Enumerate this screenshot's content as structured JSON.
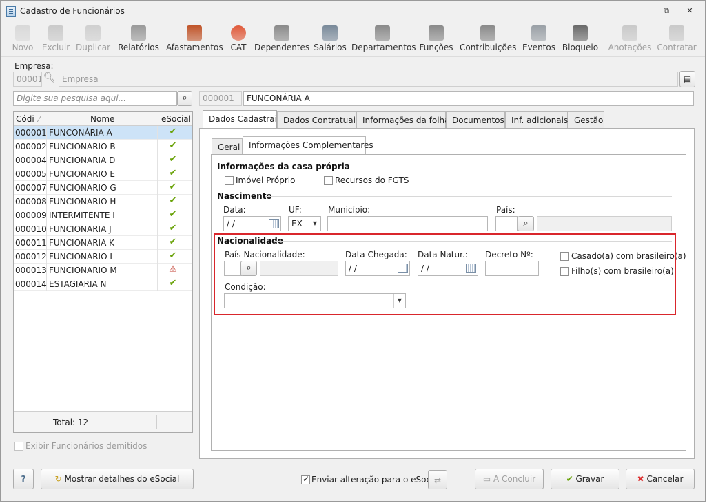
{
  "window": {
    "title": "Cadastro de Funcionários",
    "restore_glyph": "⧉",
    "close_glyph": "✕"
  },
  "toolbar": [
    {
      "label": "Novo",
      "enabled": false,
      "icon": "new-icon"
    },
    {
      "label": "Excluir",
      "enabled": false,
      "icon": "trash-icon"
    },
    {
      "label": "Duplicar",
      "enabled": false,
      "icon": "duplicate-icon"
    },
    {
      "label": "Relatórios",
      "enabled": true,
      "icon": "report-icon"
    },
    {
      "label": "Afastamentos",
      "enabled": true,
      "icon": "house-icon"
    },
    {
      "label": "CAT",
      "enabled": true,
      "icon": "red-cross-icon"
    },
    {
      "label": "Dependentes",
      "enabled": true,
      "icon": "people-icon"
    },
    {
      "label": "Salários",
      "enabled": true,
      "icon": "money-icon"
    },
    {
      "label": "Departamentos",
      "enabled": true,
      "icon": "desk-icon"
    },
    {
      "label": "Funções",
      "enabled": true,
      "icon": "badge-icon"
    },
    {
      "label": "Contribuições",
      "enabled": true,
      "icon": "heads-icon"
    },
    {
      "label": "Eventos",
      "enabled": true,
      "icon": "list-icon"
    },
    {
      "label": "Bloqueio",
      "enabled": true,
      "icon": "lock-icon"
    },
    {
      "label": "Anotações",
      "enabled": false,
      "icon": "note-icon"
    },
    {
      "label": "Contratar",
      "enabled": false,
      "icon": "contract-icon"
    }
  ],
  "empresa": {
    "label": "Empresa:",
    "code": "00001",
    "placeholder": "Empresa"
  },
  "search": {
    "placeholder": "Digite sua pesquisa aqui..."
  },
  "selected": {
    "code": "000001",
    "name": "FUNCONÁRIA A"
  },
  "grid": {
    "headers": [
      "Códi",
      "Nome",
      "eSocial"
    ],
    "rows": [
      {
        "code": "000001",
        "name": "FUNCONÁRIA A",
        "status": "✔",
        "warn": false
      },
      {
        "code": "000002",
        "name": "FUNCIONARIO B",
        "status": "✔",
        "warn": false
      },
      {
        "code": "000004",
        "name": "FUNCIONARIA D",
        "status": "✔",
        "warn": false
      },
      {
        "code": "000005",
        "name": "FUNCIONARIO E",
        "status": "✔",
        "warn": false
      },
      {
        "code": "000007",
        "name": "FUNCIONARIO G",
        "status": "✔",
        "warn": false
      },
      {
        "code": "000008",
        "name": "FUNCIONARIO H",
        "status": "✔",
        "warn": false
      },
      {
        "code": "000009",
        "name": "INTERMITENTE I",
        "status": "✔",
        "warn": false
      },
      {
        "code": "000010",
        "name": "FUNCIONARIA J",
        "status": "✔",
        "warn": false
      },
      {
        "code": "000011",
        "name": "FUNCIONARIA K",
        "status": "✔",
        "warn": false
      },
      {
        "code": "000012",
        "name": "FUNCIONARIO L",
        "status": "✔",
        "warn": false
      },
      {
        "code": "000013",
        "name": "FUNCIONARIO M",
        "status": "⚠",
        "warn": true
      },
      {
        "code": "000014",
        "name": "ESTAGIARIA N",
        "status": "✔",
        "warn": false
      }
    ],
    "total": "Total: 12"
  },
  "show_dismissed": "Exibir Funcionários demitidos",
  "tabs": [
    "Dados Cadastrais",
    "Dados Contratuais",
    "Informações da folha",
    "Documentos",
    "Inf. adicionais",
    "Gestão"
  ],
  "subtabs": [
    "Geral",
    "Informações Complementares"
  ],
  "casa": {
    "title": "Informações da casa própria",
    "imovel": "Imóvel Próprio",
    "fgts": "Recursos do FGTS"
  },
  "nascimento": {
    "title": "Nascimento",
    "data_label": "Data:",
    "data_value": " / /",
    "uf_label": "UF:",
    "uf_value": "EX",
    "municipio_label": "Município:",
    "pais_label": "País:"
  },
  "nacionalidade": {
    "title": "Nacionalidade",
    "pais_label": "País Nacionalidade:",
    "chegada_label": "Data Chegada:",
    "chegada_value": " / /",
    "natur_label": "Data Natur.:",
    "natur_value": " / /",
    "decreto_label": "Decreto Nº:",
    "casado": "Casado(a) com brasileiro(a)",
    "filhos": "Filho(s) com brasileiro(a)",
    "condicao_label": "Condição:"
  },
  "footer": {
    "help": "?",
    "detalhes": "Mostrar detalhes do eSocial",
    "enviar": "Enviar alteração para o eSocial",
    "concluir": "A Concluir",
    "gravar": "Gravar",
    "cancelar": "Cancelar"
  },
  "colors": {
    "highlight": "#d9262c",
    "selected_row": "#cde3f7",
    "ok": "#6aa30a"
  }
}
